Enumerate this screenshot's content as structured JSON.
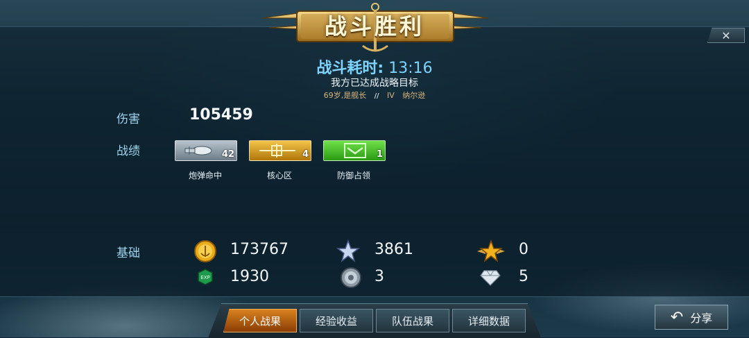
{
  "header": {
    "title": "战斗胜利",
    "close_label": "✕"
  },
  "summary": {
    "time_label": "战斗耗时:",
    "time_value": "13:16",
    "objective": "我方已达成战略目标",
    "captain_age": "69岁,是舰长",
    "captain_rank": "IV",
    "captain_name": "纳尔逊"
  },
  "damage": {
    "label": "伤害",
    "value": "105459"
  },
  "achievements": {
    "label": "战绩",
    "items": [
      {
        "count": "42",
        "caption": "炮弹命中",
        "icon": "shell-icon",
        "color": "#8a9aa6"
      },
      {
        "count": "4",
        "caption": "核心区",
        "icon": "crosshair-icon",
        "color": "#d79a1a"
      },
      {
        "count": "1",
        "caption": "防御占领",
        "icon": "shield-chevron-icon",
        "color": "#37b81f"
      }
    ]
  },
  "base": {
    "label": "基础",
    "rows": [
      [
        {
          "icon": "gold-coin-icon",
          "value": "173767"
        },
        {
          "icon": "silver-star-icon",
          "value": "3861"
        },
        {
          "icon": "gold-star-icon",
          "value": "0"
        }
      ],
      [
        {
          "icon": "exp-icon",
          "value": "1930"
        },
        {
          "icon": "silver-medal-icon",
          "value": "3"
        },
        {
          "icon": "diamond-icon",
          "value": "5"
        }
      ]
    ]
  },
  "tabs": [
    {
      "label": "个人战果",
      "active": true
    },
    {
      "label": "经验收益",
      "active": false
    },
    {
      "label": "队伍战果",
      "active": false
    },
    {
      "label": "详细数据",
      "active": false
    }
  ],
  "share_label": "分享"
}
